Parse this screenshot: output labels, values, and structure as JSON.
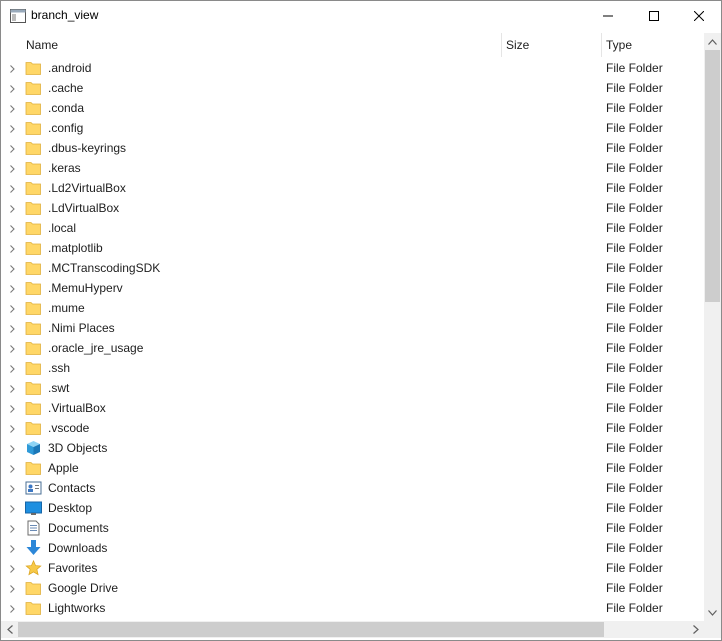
{
  "window": {
    "title": "branch_view"
  },
  "columns": {
    "name": "Name",
    "size": "Size",
    "type": "Type"
  },
  "rows": [
    {
      "name": ".android",
      "type": "File Folder",
      "icon": "folder-icon"
    },
    {
      "name": ".cache",
      "type": "File Folder",
      "icon": "folder-icon"
    },
    {
      "name": ".conda",
      "type": "File Folder",
      "icon": "folder-icon"
    },
    {
      "name": ".config",
      "type": "File Folder",
      "icon": "folder-icon"
    },
    {
      "name": ".dbus-keyrings",
      "type": "File Folder",
      "icon": "folder-icon"
    },
    {
      "name": ".keras",
      "type": "File Folder",
      "icon": "folder-icon"
    },
    {
      "name": ".Ld2VirtualBox",
      "type": "File Folder",
      "icon": "folder-icon"
    },
    {
      "name": ".LdVirtualBox",
      "type": "File Folder",
      "icon": "folder-icon"
    },
    {
      "name": ".local",
      "type": "File Folder",
      "icon": "folder-icon"
    },
    {
      "name": ".matplotlib",
      "type": "File Folder",
      "icon": "folder-icon"
    },
    {
      "name": ".MCTranscodingSDK",
      "type": "File Folder",
      "icon": "folder-icon"
    },
    {
      "name": ".MemuHyperv",
      "type": "File Folder",
      "icon": "folder-icon"
    },
    {
      "name": ".mume",
      "type": "File Folder",
      "icon": "folder-icon"
    },
    {
      "name": ".Nimi Places",
      "type": "File Folder",
      "icon": "folder-icon"
    },
    {
      "name": ".oracle_jre_usage",
      "type": "File Folder",
      "icon": "folder-icon"
    },
    {
      "name": ".ssh",
      "type": "File Folder",
      "icon": "folder-icon"
    },
    {
      "name": ".swt",
      "type": "File Folder",
      "icon": "folder-icon"
    },
    {
      "name": ".VirtualBox",
      "type": "File Folder",
      "icon": "folder-icon"
    },
    {
      "name": ".vscode",
      "type": "File Folder",
      "icon": "folder-icon"
    },
    {
      "name": "3D Objects",
      "type": "File Folder",
      "icon": "3d-objects-icon"
    },
    {
      "name": "Apple",
      "type": "File Folder",
      "icon": "folder-icon"
    },
    {
      "name": "Contacts",
      "type": "File Folder",
      "icon": "contacts-icon"
    },
    {
      "name": "Desktop",
      "type": "File Folder",
      "icon": "desktop-icon"
    },
    {
      "name": "Documents",
      "type": "File Folder",
      "icon": "documents-icon"
    },
    {
      "name": "Downloads",
      "type": "File Folder",
      "icon": "downloads-icon"
    },
    {
      "name": "Favorites",
      "type": "File Folder",
      "icon": "favorites-icon"
    },
    {
      "name": "Google Drive",
      "type": "File Folder",
      "icon": "folder-icon"
    },
    {
      "name": "Lightworks",
      "type": "File Folder",
      "icon": "folder-icon"
    }
  ],
  "colors": {
    "folder": "#ffd767",
    "scroll_track": "#f0f0f0",
    "scroll_thumb": "#cdcdcd"
  }
}
